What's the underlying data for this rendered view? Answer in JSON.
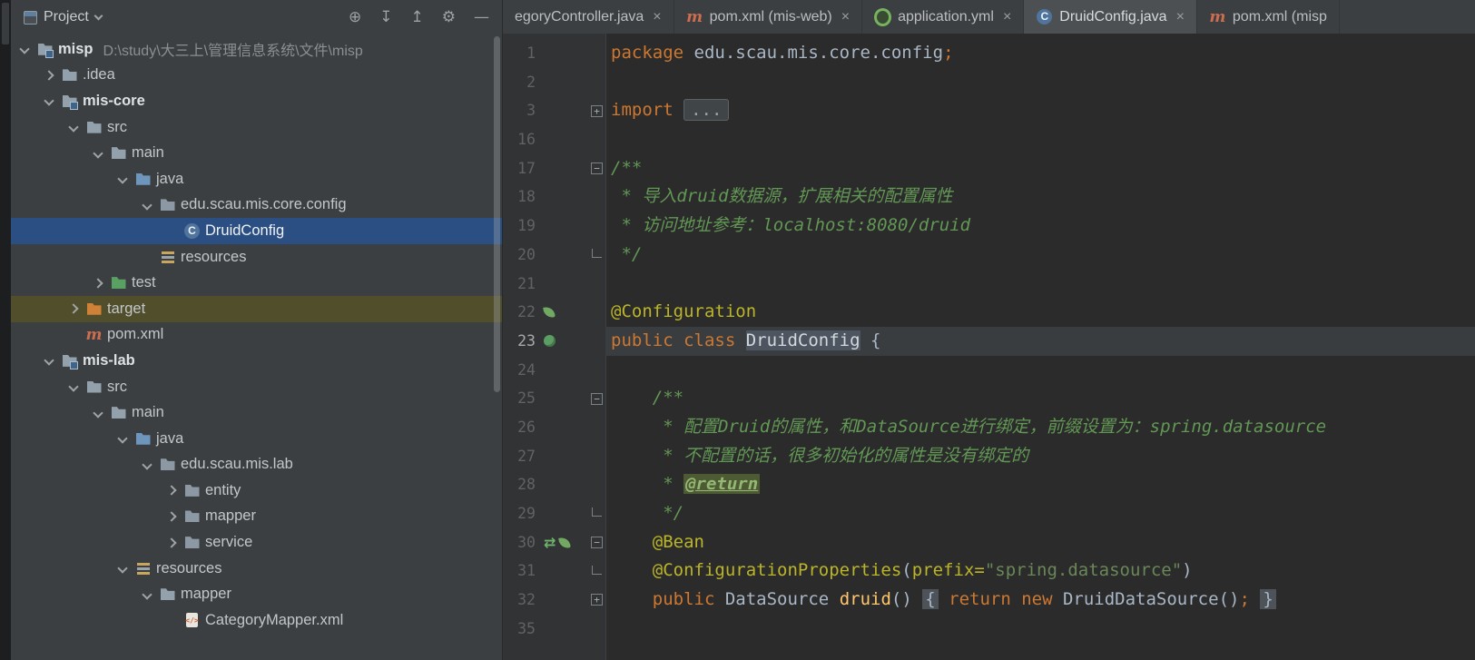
{
  "project_panel": {
    "header": {
      "title": "Project",
      "actions": [
        {
          "name": "locate-file-icon",
          "glyph": "⊕"
        },
        {
          "name": "scroll-to-source-icon",
          "glyph": "↧"
        },
        {
          "name": "collapse-all-icon",
          "glyph": "↥"
        },
        {
          "name": "settings-gear-icon",
          "glyph": "⚙"
        },
        {
          "name": "hide-panel-icon",
          "glyph": "—"
        }
      ]
    },
    "tree": [
      {
        "label": "misp",
        "path": "D:\\study\\大三上\\管理信息系统\\文件\\misp",
        "level": 0,
        "chevron": "expanded",
        "icon": "module-folder",
        "bold": true
      },
      {
        "label": ".idea",
        "level": 1,
        "chevron": "collapsed",
        "icon": "folder"
      },
      {
        "label": "mis-core",
        "level": 1,
        "chevron": "expanded",
        "icon": "module-folder",
        "bold": true
      },
      {
        "label": "src",
        "level": 2,
        "chevron": "expanded",
        "icon": "folder"
      },
      {
        "label": "main",
        "level": 3,
        "chevron": "expanded",
        "icon": "folder"
      },
      {
        "label": "java",
        "level": 4,
        "chevron": "expanded",
        "icon": "folder-src"
      },
      {
        "label": "edu.scau.mis.core.config",
        "level": 5,
        "chevron": "expanded",
        "icon": "package"
      },
      {
        "label": "DruidConfig",
        "level": 6,
        "chevron": "none",
        "icon": "class",
        "selected": true
      },
      {
        "label": "resources",
        "level": 5,
        "chevron": "none",
        "icon": "resources"
      },
      {
        "label": "test",
        "level": 3,
        "chevron": "collapsed",
        "icon": "folder-test"
      },
      {
        "label": "target",
        "level": 2,
        "chevron": "collapsed",
        "icon": "folder-excluded",
        "highlight": "olive"
      },
      {
        "label": "pom.xml",
        "level": 2,
        "chevron": "none",
        "icon": "maven"
      },
      {
        "label": "mis-lab",
        "level": 1,
        "chevron": "expanded",
        "icon": "module-folder",
        "bold": true
      },
      {
        "label": "src",
        "level": 2,
        "chevron": "expanded",
        "icon": "folder"
      },
      {
        "label": "main",
        "level": 3,
        "chevron": "expanded",
        "icon": "folder"
      },
      {
        "label": "java",
        "level": 4,
        "chevron": "expanded",
        "icon": "folder-src"
      },
      {
        "label": "edu.scau.mis.lab",
        "level": 5,
        "chevron": "expanded",
        "icon": "package"
      },
      {
        "label": "entity",
        "level": 6,
        "chevron": "collapsed",
        "icon": "package"
      },
      {
        "label": "mapper",
        "level": 6,
        "chevron": "collapsed",
        "icon": "package"
      },
      {
        "label": "service",
        "level": 6,
        "chevron": "collapsed",
        "icon": "package"
      },
      {
        "label": "resources",
        "level": 4,
        "chevron": "expanded",
        "icon": "resources"
      },
      {
        "label": "mapper",
        "level": 5,
        "chevron": "expanded",
        "icon": "folder"
      },
      {
        "label": "CategoryMapper.xml",
        "level": 6,
        "chevron": "none",
        "icon": "xml"
      }
    ]
  },
  "editor": {
    "tabs": [
      {
        "label": "egoryController.java",
        "icon": "none",
        "close": true
      },
      {
        "label": "pom.xml (mis-web)",
        "icon": "maven",
        "close": true
      },
      {
        "label": "application.yml",
        "icon": "spring-config",
        "close": true
      },
      {
        "label": "DruidConfig.java",
        "icon": "class",
        "close": true,
        "active": true
      },
      {
        "label": "pom.xml (misp",
        "icon": "maven",
        "close": false
      }
    ],
    "lines": [
      {
        "n": "1",
        "marks": [],
        "segs": [
          [
            "kw",
            "package "
          ],
          [
            "pl",
            "edu.scau.mis.core.config"
          ],
          [
            "kw",
            ";"
          ]
        ]
      },
      {
        "n": "2",
        "marks": [],
        "segs": []
      },
      {
        "n": "3",
        "marks": [
          "fold-plus"
        ],
        "segs": [
          [
            "kw",
            "import "
          ],
          [
            "fold",
            "..."
          ]
        ]
      },
      {
        "n": "16",
        "marks": [],
        "segs": []
      },
      {
        "n": "17",
        "marks": [
          "fold-start"
        ],
        "segs": [
          [
            "cm",
            "/**"
          ]
        ]
      },
      {
        "n": "18",
        "marks": [],
        "segs": [
          [
            "cm",
            " * 导入druid数据源，扩展相关的配置属性"
          ]
        ]
      },
      {
        "n": "19",
        "marks": [],
        "segs": [
          [
            "cm",
            " * 访问地址参考：localhost:8080/druid"
          ]
        ]
      },
      {
        "n": "20",
        "marks": [
          "fold-end"
        ],
        "segs": [
          [
            "cm",
            " */"
          ]
        ]
      },
      {
        "n": "21",
        "marks": [],
        "segs": []
      },
      {
        "n": "22",
        "marks": [
          "spring-leaf"
        ],
        "segs": [
          [
            "ann",
            "@Configuration"
          ]
        ]
      },
      {
        "n": "23",
        "marks": [
          "spring-bean"
        ],
        "caret": true,
        "segs": [
          [
            "kw",
            "public class "
          ],
          [
            "idhl",
            "DruidConfig"
          ],
          [
            "pl",
            " {"
          ]
        ]
      },
      {
        "n": "24",
        "marks": [],
        "segs": []
      },
      {
        "n": "25",
        "marks": [
          "fold-start"
        ],
        "segs": [
          [
            "cm",
            "    /**"
          ]
        ]
      },
      {
        "n": "26",
        "marks": [],
        "segs": [
          [
            "cm",
            "     * 配置Druid的属性，和DataSource进行绑定，前缀设置为：spring.datasource"
          ]
        ]
      },
      {
        "n": "27",
        "marks": [],
        "segs": [
          [
            "cm",
            "     * 不配置的话，很多初始化的属性是没有绑定的"
          ]
        ]
      },
      {
        "n": "28",
        "marks": [],
        "segs": [
          [
            "cm",
            "     * "
          ],
          [
            "tag",
            "@return"
          ]
        ]
      },
      {
        "n": "29",
        "marks": [
          "fold-end"
        ],
        "segs": [
          [
            "cm",
            "     */"
          ]
        ]
      },
      {
        "n": "30",
        "marks": [
          "nav-arrows",
          "spring-leaf",
          "fold-start"
        ],
        "segs": [
          [
            "ann",
            "    @Bean"
          ]
        ]
      },
      {
        "n": "31",
        "marks": [
          "fold-end"
        ],
        "segs": [
          [
            "ann",
            "    @ConfigurationProperties"
          ],
          [
            "pl",
            "("
          ],
          [
            "ann",
            "prefix="
          ],
          [
            "str",
            "\"spring.datasource\""
          ],
          [
            "pl",
            ")"
          ]
        ]
      },
      {
        "n": "32",
        "marks": [
          "fold-plus"
        ],
        "segs": [
          [
            "kw",
            "    public "
          ],
          [
            "pl",
            "DataSource "
          ],
          [
            "meth",
            "druid"
          ],
          [
            "pl",
            "() "
          ],
          [
            "brace",
            "{"
          ],
          [
            "pl",
            " "
          ],
          [
            "kw",
            "return "
          ],
          [
            "kw",
            "new "
          ],
          [
            "pl",
            "DruidDataSource"
          ],
          [
            "pl",
            "()"
          ],
          [
            "kw",
            ";"
          ],
          [
            "pl",
            " "
          ],
          [
            "brace",
            "}"
          ]
        ]
      },
      {
        "n": "35",
        "marks": [],
        "segs": []
      }
    ]
  }
}
